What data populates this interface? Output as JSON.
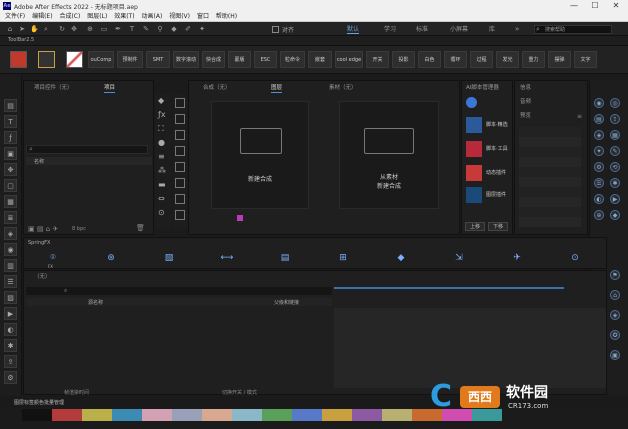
{
  "window": {
    "app_icon": "Ae",
    "title": "Adobe After Effects 2022 - 无标题项目.aep",
    "minimize": "—",
    "maximize": "☐",
    "close": "✕"
  },
  "menu": [
    "文件(F)",
    "编辑(E)",
    "合成(C)",
    "图层(L)",
    "效果(T)",
    "动画(A)",
    "视图(V)",
    "窗口",
    "帮助(H)"
  ],
  "toolbar": {
    "snap_label": "对齐",
    "workspaces": [
      "默认",
      "学习",
      "标准",
      "小屏幕",
      "库"
    ],
    "active_workspace": "默认",
    "search_placeholder": "搜索帮助"
  },
  "toolbar2": {
    "label": "ToolBar2.5"
  },
  "extension_buttons": [
    "ouComp",
    "预制件",
    "SMT",
    "数字滚动",
    "快合成",
    "蒙版",
    "ESC",
    "粒命令",
    "嵌套",
    "cool edge",
    "开关",
    "投影",
    "白色",
    "循环",
    "过程",
    "发光",
    "重力",
    "摆弹",
    "文字"
  ],
  "project_panel": {
    "tab": "项目控件（无）",
    "tab2": "项目",
    "search_icon": "⌕",
    "column_name": "名称",
    "bpc": "8 bpc"
  },
  "comp_panel": {
    "tabs": [
      "合成（无）",
      "图层",
      "素材（无）"
    ],
    "active_tab": "图层",
    "new_comp_label": "新建合成",
    "from_footage_line1": "从素材",
    "from_footage_line2": "新建合成"
  },
  "ai_panel": {
    "title": "AI脚本管理器",
    "items": [
      "脚本·精选",
      "脚本·工具",
      "动态插件",
      "图层插件"
    ],
    "footer_up": "上移",
    "footer_down": "下移"
  },
  "info_panel": {
    "items": [
      "信息",
      "音频",
      "预览"
    ]
  },
  "spring_panel": {
    "title": "SpringFX",
    "label": "FX"
  },
  "timeline": {
    "tab": "（无）",
    "search_icon": "⌕",
    "col_layer_name": "源名称",
    "col_parent": "父级和链接",
    "status_left": "帧渲染时间",
    "status_mid": "切换开关 / 模式"
  },
  "bottom_bar": {
    "label": "图层标签颜色批量管理"
  },
  "watermark": {
    "brand": "软件园",
    "site": "CR173.com",
    "prefix": "西西"
  },
  "colors": {
    "swatches": [
      "#111111",
      "#b33b3b",
      "#b9b04a",
      "#3b8bb3",
      "#d4a0b4",
      "#9aa0b8",
      "#d8a890",
      "#8ab8c8",
      "#5aa05a",
      "#5878c8",
      "#c8a040",
      "#8b5aa0",
      "#b8b070",
      "#c86a30",
      "#d04cb0",
      "#3a9a9a"
    ]
  }
}
